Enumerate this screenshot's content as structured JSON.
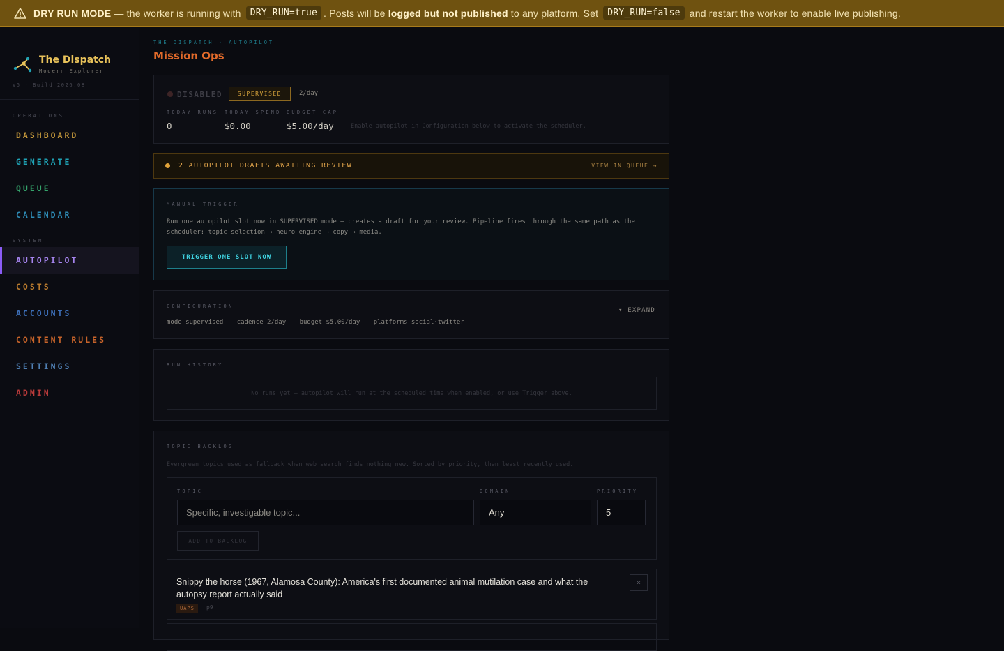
{
  "banner": {
    "mode": "DRY RUN MODE",
    "text1": " — the worker is running with ",
    "code1": "DRY_RUN=true",
    "text2": ". Posts will be ",
    "bold2": "logged but not published",
    "text3": " to any platform. Set ",
    "code2": "DRY_RUN=false",
    "text4": " and restart the worker to enable live publishing."
  },
  "brand": {
    "name": "The Dispatch",
    "tagline": "Modern Explorer",
    "build": "v5 · Build 2026.08"
  },
  "sidebar": {
    "operations_label": "OPERATIONS",
    "system_label": "SYSTEM",
    "items": [
      {
        "label": "DASHBOARD",
        "color": "#c79a3c"
      },
      {
        "label": "GENERATE",
        "color": "#1fa2b4"
      },
      {
        "label": "QUEUE",
        "color": "#35a36b"
      },
      {
        "label": "CALENDAR",
        "color": "#2e8bb5"
      },
      {
        "label": "AUTOPILOT",
        "color": "#a785f0"
      },
      {
        "label": "COSTS",
        "color": "#b87a2e"
      },
      {
        "label": "ACCOUNTS",
        "color": "#3d6fb8"
      },
      {
        "label": "CONTENT RULES",
        "color": "#c8642a"
      },
      {
        "label": "SETTINGS",
        "color": "#4f7fb3"
      },
      {
        "label": "ADMIN",
        "color": "#b83a3a"
      }
    ]
  },
  "header": {
    "breadcrumb": "THE DISPATCH · AUTOPILOT",
    "title": "Mission Ops"
  },
  "status": {
    "state": "DISABLED",
    "mode": "SUPERVISED",
    "cadence": "2/day",
    "today_runs_label": "TODAY RUNS",
    "today_runs": "0",
    "today_spend_label": "TODAY SPEND",
    "today_spend": "$0.00",
    "budget_cap_label": "BUDGET CAP",
    "budget_cap": "$5.00/day",
    "hint": "Enable autopilot in Configuration below to activate the scheduler."
  },
  "drafts": {
    "text": "2 AUTOPILOT DRAFTS AWAITING REVIEW",
    "link": "VIEW IN QUEUE →"
  },
  "manual_trigger": {
    "label": "MANUAL TRIGGER",
    "description": "Run one autopilot slot now in SUPERVISED mode — creates a draft for your review. Pipeline fires through the same path as the scheduler: topic selection → neuro engine → copy → media.",
    "button": "TRIGGER ONE SLOT NOW"
  },
  "configuration": {
    "label": "CONFIGURATION",
    "expand": "▾ EXPAND",
    "mode": "mode supervised",
    "cadence": "cadence 2/day",
    "budget": "budget $5.00/day",
    "platforms": "platforms social·twitter"
  },
  "run_history": {
    "label": "RUN HISTORY",
    "empty": "No runs yet — autopilot will run at the scheduled time when enabled, or use Trigger above."
  },
  "topic_backlog": {
    "label": "TOPIC BACKLOG",
    "description": "Evergreen topics used as fallback when web search finds nothing new. Sorted by priority, then least recently used.",
    "topic_label": "TOPIC",
    "topic_placeholder": "Specific, investigable topic...",
    "domain_label": "DOMAIN",
    "domain_value": "Any",
    "priority_label": "PRIORITY",
    "priority_value": "5",
    "add_button": "ADD TO BACKLOG",
    "items": [
      {
        "text": "Snippy the horse (1967, Alamosa County): America's first documented animal mutilation case and what the autopsy report actually said",
        "domain": "UAPS",
        "priority": "p9",
        "remove": "×"
      }
    ]
  },
  "colors": {
    "accent_active": "#8b5cf6",
    "title": "#e16a2a",
    "banner": "#6f5210"
  }
}
